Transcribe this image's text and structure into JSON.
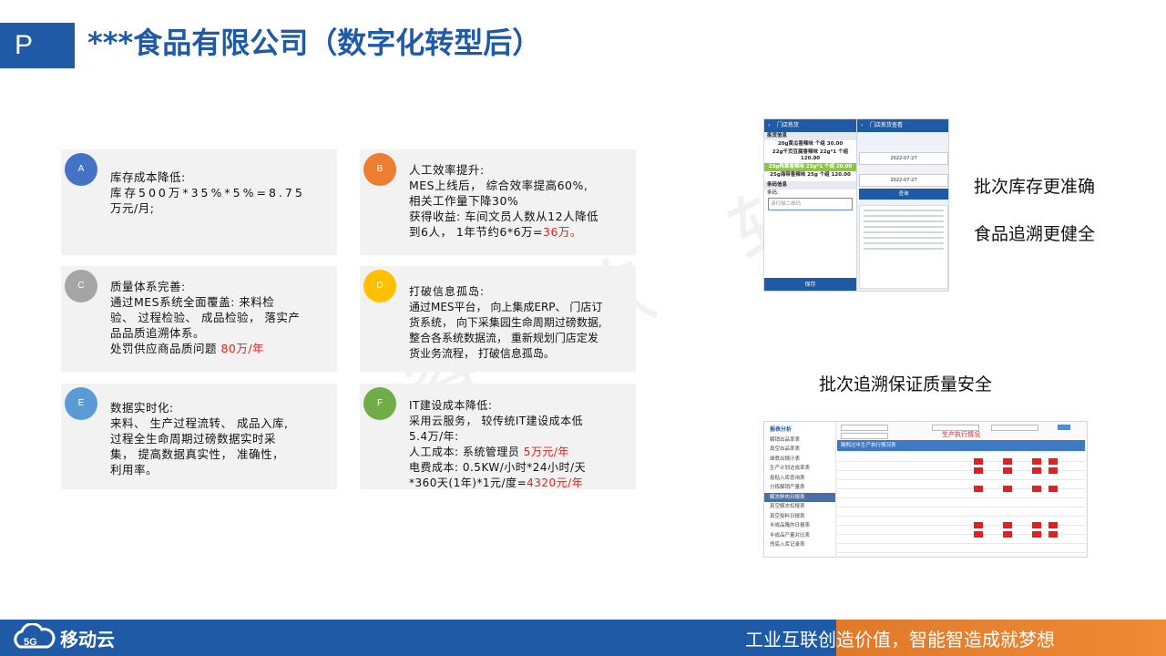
{
  "header": {
    "badge": "P",
    "title": "***食品有限公司（数字化转型后）"
  },
  "cards": [
    {
      "badge": "A",
      "color": "#4472c4",
      "lines": [
        {
          "t": "库存成本降低:"
        },
        {
          "t": "库存500万*35%*5%=8.75"
        },
        {
          "t": "万元/月;"
        }
      ]
    },
    {
      "badge": "B",
      "color": "#ed7d31",
      "lines": [
        {
          "t": "人工效率提升:"
        },
        {
          "t": "MES上线后， 综合效率提高60%,"
        },
        {
          "t": "相关工作量下降30%"
        },
        {
          "t": "获得收益:  车间文员人数从12人降低"
        },
        {
          "t": "到6人，  1年节约6*6万=",
          "red": "36万。"
        }
      ]
    },
    {
      "badge": "C",
      "color": "#a5a5a5",
      "lines": [
        {
          "t": "质量体系完善:"
        },
        {
          "t": "通过MES系统全面覆盖:  来料检"
        },
        {
          "t": "验、 过程检验、 成品检验， 落实产"
        },
        {
          "t": "品品质追溯体系。"
        },
        {
          "t": "处罚供应商品质问题 ",
          "red": "80万/年"
        }
      ]
    },
    {
      "badge": "D",
      "color": "#ffc000",
      "lines": [
        {
          "t": "打破信息孤岛:"
        },
        {
          "t": "通过MES平台， 向上集成ERP、 门店订"
        },
        {
          "t": "货系统， 向下采集园生命周期过磅数据,"
        },
        {
          "t": "整合各系统数据流， 重新规划门店定发"
        },
        {
          "t": "货业务流程， 打破信息孤岛。"
        }
      ]
    },
    {
      "badge": "E",
      "color": "#5b9bd5",
      "lines": [
        {
          "t": "数据实时化:"
        },
        {
          "t": "来料、 生产过程流转、 成品入库,"
        },
        {
          "t": "过程全生命周期过磅数据实时采"
        },
        {
          "t": "集， 提高数据真实性， 准确性，"
        },
        {
          "t": "利用率。"
        }
      ]
    },
    {
      "badge": "F",
      "color": "#70ad47",
      "lines": [
        {
          "t": "IT建设成本降低:"
        },
        {
          "t": "采用云服务， 较传统IT建设成本低"
        },
        {
          "t": "5.4万/年:"
        },
        {
          "t": "人工成本:  系统管理员 ",
          "red": "5万元/年"
        },
        {
          "t": "电费成本:  0.5KW/小时*24小时/天"
        },
        {
          "t": "*360天(1年)*1元/度=",
          "red": "4320元/年"
        }
      ]
    }
  ],
  "captions": {
    "c1": "批次库存更准确",
    "c2": "食品追溯更健全",
    "c3": "批次追溯保证质量安全"
  },
  "mobile": {
    "left_title": "门店拣货",
    "right_title": "门店拣货查看",
    "section1": "拣货信息",
    "items": [
      "20g黄瓜香辣味 个组 30.00",
      "22g千页豆腐香辣味 22g*1 个组 120.00",
      "23g鸭掌香辣味 23g*1 个组 20.00",
      "25g海带香辣味 25g 个组 120.00"
    ],
    "section2": "条码信息",
    "barcode_label": "条码:",
    "barcode_placeholder": "请扫描二维码",
    "save": "保存",
    "query": "查询",
    "dates": [
      "2022-07-27",
      "2022-07-27"
    ]
  },
  "report": {
    "menu_title": "报表分析",
    "menu": [
      "解销出品率表",
      "真空出品率表",
      "焯煮出锅汁表",
      "生产计划达成率表",
      "投贴入库查询表",
      "分拣解销产量表",
      "解冻鲜肉日报表",
      "真空解冻扣报表",
      "真空投料日报表",
      "半成品腌炸日报表",
      "半成品产量对比表",
      "兜底入库记录表"
    ],
    "banner": "生产执行情况",
    "sub": "腌鸭过半生产执行情况表"
  },
  "footer": {
    "logo": "移动云",
    "slogan": "工业互联创造价值，智能智造成就梦想"
  },
  "watermark": "睿 歌 软"
}
